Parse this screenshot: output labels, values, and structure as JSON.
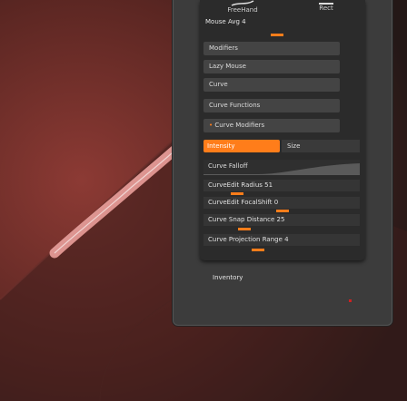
{
  "tools": {
    "freehand_label": "FreeHand",
    "rect_label": "Rect"
  },
  "mouse_avg": "Mouse Avg 4",
  "menu": {
    "modifiers": "Modifiers",
    "lazy_mouse": "Lazy Mouse",
    "curve": "Curve",
    "curve_functions": "Curve Functions",
    "curve_modifiers": "Curve Modifiers",
    "intensity": "Intensity",
    "size": "Size",
    "curve_falloff": "Curve Falloff",
    "curveedit_radius": "CurveEdit Radius 51",
    "curveedit_focalshift": "CurveEdit FocalShift 0",
    "curve_snap_distance": "Curve Snap Distance 25",
    "curve_projection_range": "Curve Projection Range 4"
  },
  "inventory_label": "Inventory",
  "colors": {
    "accent": "#ff7d1a",
    "menu_bg": "#2b2b2b",
    "panel_bg": "#3c3c3c"
  }
}
